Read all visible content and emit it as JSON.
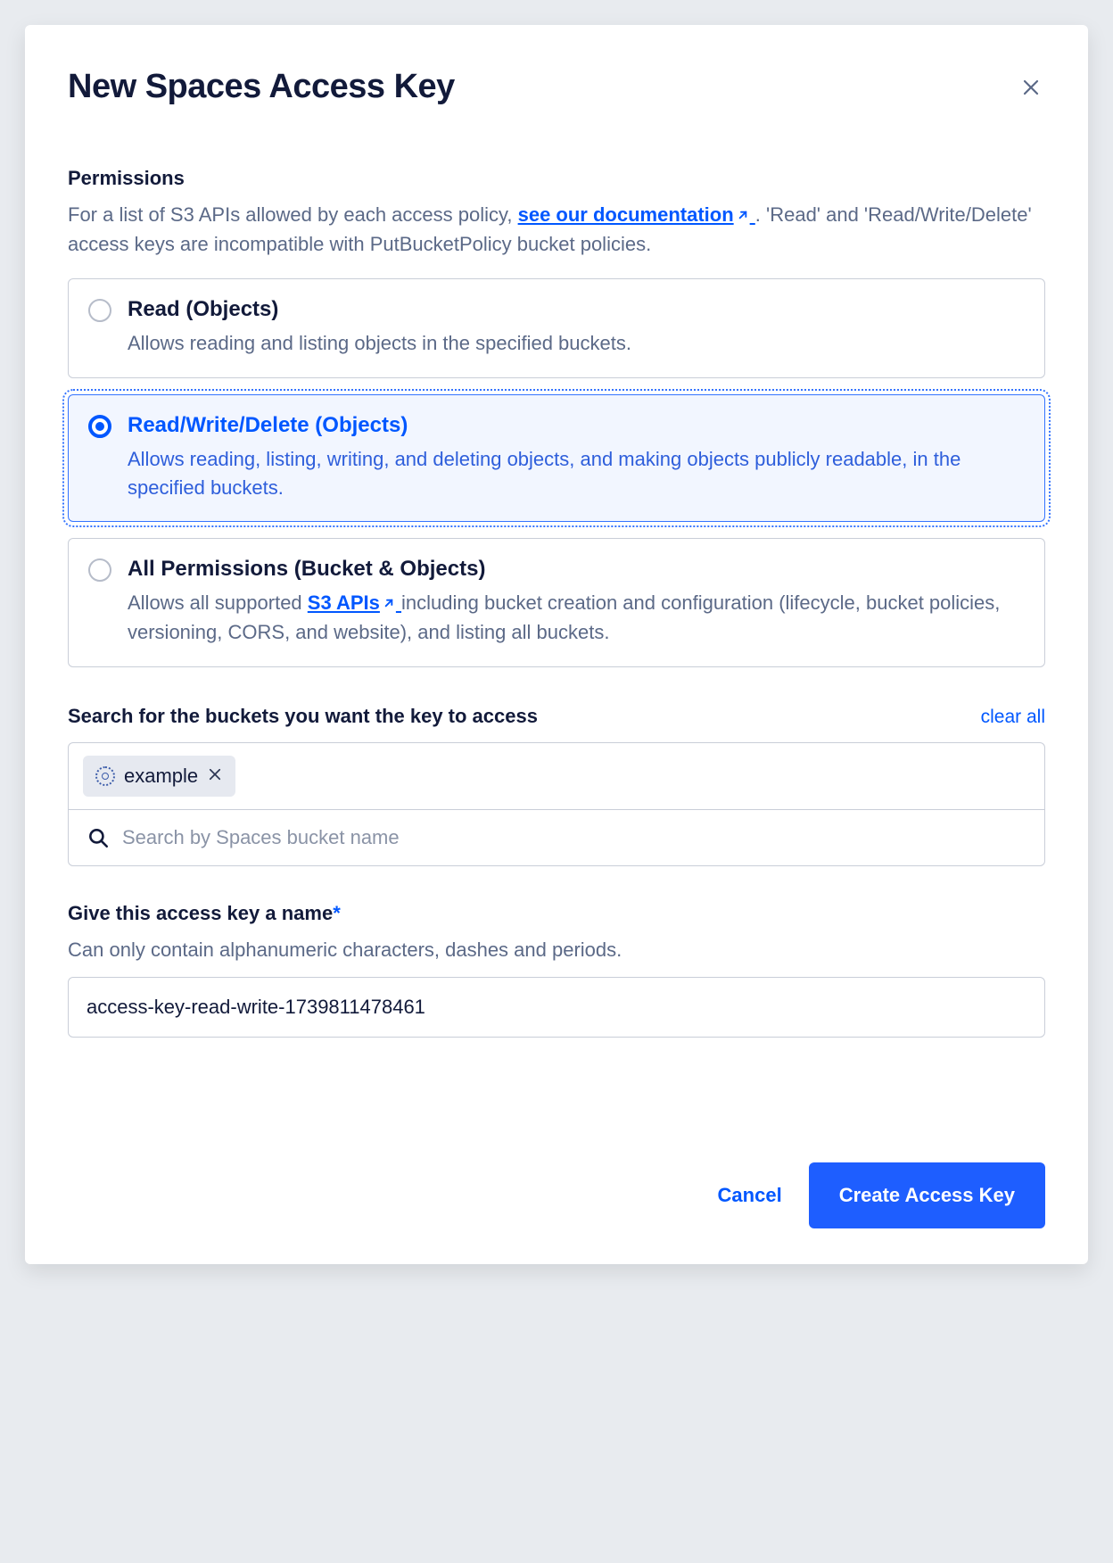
{
  "modal": {
    "title": "New Spaces Access Key"
  },
  "permissions": {
    "label": "Permissions",
    "description_prefix": "For a list of S3 APIs allowed by each access policy, ",
    "doc_link": "see our documentation",
    "description_suffix": " . 'Read' and 'Read/Write/Delete' access keys are incompatible with PutBucketPolicy bucket policies.",
    "options": [
      {
        "title": "Read (Objects)",
        "description": "Allows reading and listing objects in the specified buckets.",
        "selected": false
      },
      {
        "title": "Read/Write/Delete (Objects)",
        "description": "Allows reading, listing, writing, and deleting objects, and making objects publicly readable, in the specified buckets.",
        "selected": true
      },
      {
        "title": "All Permissions (Bucket & Objects)",
        "desc_prefix": "Allows all supported ",
        "desc_link": "S3 APIs",
        "desc_suffix": " including bucket creation and configuration (lifecycle, bucket policies, versioning, CORS, and website), and listing all buckets.",
        "selected": false
      }
    ]
  },
  "buckets": {
    "label": "Search for the buckets you want the key to access",
    "clear": "clear all",
    "chips": [
      {
        "name": "example"
      }
    ],
    "search_placeholder": "Search by Spaces bucket name"
  },
  "name": {
    "label": "Give this access key a name",
    "hint": "Can only contain alphanumeric characters, dashes and periods.",
    "value": "access-key-read-write-1739811478461"
  },
  "footer": {
    "cancel": "Cancel",
    "create": "Create Access Key"
  }
}
